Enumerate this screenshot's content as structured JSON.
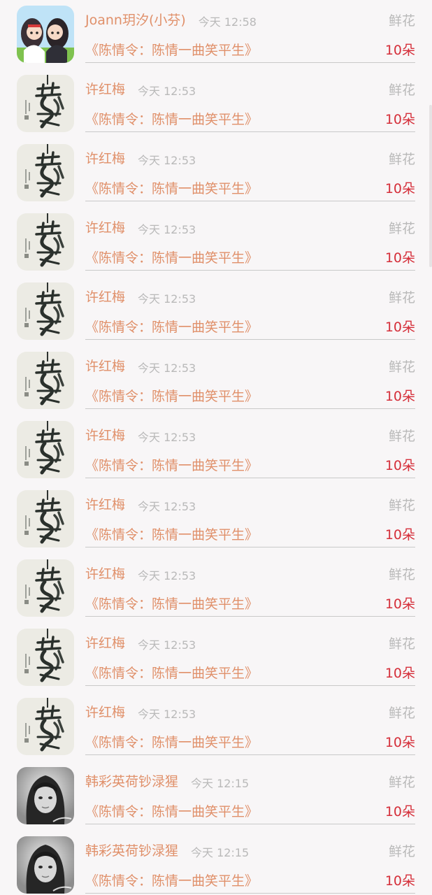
{
  "records": [
    {
      "name": "Joann玥汐(小芬)",
      "time": "今天 12:58",
      "gift_type": "鲜花",
      "work": "《陈情令：陈情一曲笑平生》",
      "count": "10朵",
      "avatar": "cartoon"
    },
    {
      "name": "许红梅",
      "time": "今天 12:53",
      "gift_type": "鲜花",
      "work": "《陈情令：陈情一曲笑平生》",
      "count": "10朵",
      "avatar": "calligraphy"
    },
    {
      "name": "许红梅",
      "time": "今天 12:53",
      "gift_type": "鲜花",
      "work": "《陈情令：陈情一曲笑平生》",
      "count": "10朵",
      "avatar": "calligraphy"
    },
    {
      "name": "许红梅",
      "time": "今天 12:53",
      "gift_type": "鲜花",
      "work": "《陈情令：陈情一曲笑平生》",
      "count": "10朵",
      "avatar": "calligraphy"
    },
    {
      "name": "许红梅",
      "time": "今天 12:53",
      "gift_type": "鲜花",
      "work": "《陈情令：陈情一曲笑平生》",
      "count": "10朵",
      "avatar": "calligraphy"
    },
    {
      "name": "许红梅",
      "time": "今天 12:53",
      "gift_type": "鲜花",
      "work": "《陈情令：陈情一曲笑平生》",
      "count": "10朵",
      "avatar": "calligraphy"
    },
    {
      "name": "许红梅",
      "time": "今天 12:53",
      "gift_type": "鲜花",
      "work": "《陈情令：陈情一曲笑平生》",
      "count": "10朵",
      "avatar": "calligraphy"
    },
    {
      "name": "许红梅",
      "time": "今天 12:53",
      "gift_type": "鲜花",
      "work": "《陈情令：陈情一曲笑平生》",
      "count": "10朵",
      "avatar": "calligraphy"
    },
    {
      "name": "许红梅",
      "time": "今天 12:53",
      "gift_type": "鲜花",
      "work": "《陈情令：陈情一曲笑平生》",
      "count": "10朵",
      "avatar": "calligraphy"
    },
    {
      "name": "许红梅",
      "time": "今天 12:53",
      "gift_type": "鲜花",
      "work": "《陈情令：陈情一曲笑平生》",
      "count": "10朵",
      "avatar": "calligraphy"
    },
    {
      "name": "许红梅",
      "time": "今天 12:53",
      "gift_type": "鲜花",
      "work": "《陈情令：陈情一曲笑平生》",
      "count": "10朵",
      "avatar": "calligraphy"
    },
    {
      "name": "韩彩英荷钞渌猩",
      "time": "今天 12:15",
      "gift_type": "鲜花",
      "work": "《陈情令：陈情一曲笑平生》",
      "count": "10朵",
      "avatar": "portrait"
    },
    {
      "name": "韩彩英荷钞渌猩",
      "time": "今天 12:15",
      "gift_type": "鲜花",
      "work": "《陈情令：陈情一曲笑平生》",
      "count": "10朵",
      "avatar": "portrait"
    }
  ],
  "colors": {
    "name": "#e0906a",
    "muted": "#b9b9b9",
    "count": "#d52f3a",
    "background": "#f8f6f7"
  }
}
